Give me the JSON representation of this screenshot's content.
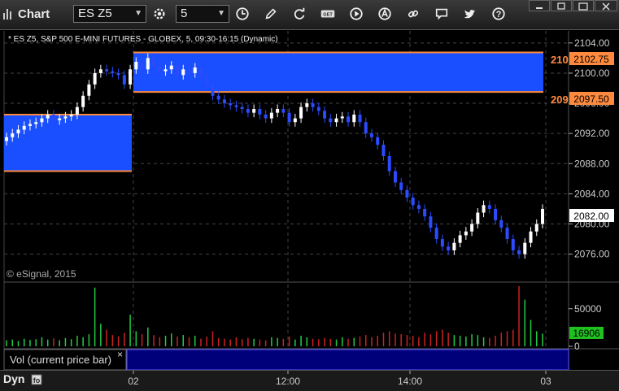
{
  "toolbar": {
    "app_title": "Chart",
    "symbol": "ES Z5",
    "interval": "5"
  },
  "chart": {
    "header": "* ES Z5, S&P 500 E-MINI FUTURES - GLOBEX, 5, 09:30-16:15 (Dynamic)",
    "copyright": "© eSignal, 2015",
    "price_ticks": [
      "2104.00",
      "2100.00",
      "2096.00",
      "2092.00",
      "2088.00",
      "2084.00",
      "2080.00",
      "2076.00"
    ],
    "price_min": 2072.4,
    "price_max": 2105.6,
    "current_price": "2082.00",
    "upper_level": "2102.75",
    "upper_level_clipped": "210",
    "lower_level": "2097.50",
    "lower_level_clipped": "209",
    "time_labels": [
      "02",
      "12:00",
      "14:00",
      "03"
    ],
    "volume_ticks": [
      "50000",
      "0"
    ],
    "volume_current": "16906",
    "volume_max": 80000,
    "volume_panel_label": "Vol (current price bar)",
    "close_mark": "×",
    "status_label": "Dyn",
    "colors": {
      "box": "#1a4fff",
      "level_line": "#ff8a3d",
      "up": "#ffffff",
      "down": "#2b4bff",
      "vol_up": "#22cc44",
      "vol_down": "#cc2222",
      "price_tag": "#ffffff",
      "vol_tag": "#21c021"
    }
  },
  "chart_data": {
    "type": "candlestick",
    "boxes": [
      {
        "session": "prior",
        "high": 2094.5,
        "low": 2087.0
      },
      {
        "session": "current",
        "high": 2102.75,
        "low": 2097.5
      }
    ],
    "closes": [
      2091.5,
      2092.0,
      2092.5,
      2093.0,
      2093.25,
      2093.5,
      2094.0,
      2094.5,
      2093.75,
      2094.0,
      2094.25,
      2094.5,
      2095.5,
      2097.0,
      2098.5,
      2100.0,
      2100.5,
      2100.25,
      2100.0,
      2099.75,
      2098.5,
      2100.5,
      2101.5,
      2100.5,
      2102.0,
      2101.0,
      2100.25,
      2100.5,
      2101.0,
      2099.75,
      2100.5,
      2100.0,
      2100.75,
      2099.5,
      2098.5,
      2097.0,
      2096.5,
      2096.0,
      2095.75,
      2095.5,
      2095.25,
      2094.75,
      2095.25,
      2094.5,
      2094.0,
      2094.75,
      2095.25,
      2094.75,
      2093.5,
      2094.0,
      2095.5,
      2096.0,
      2095.5,
      2095.0,
      2094.0,
      2093.5,
      2094.0,
      2094.25,
      2093.5,
      2094.5,
      2093.5,
      2092.0,
      2091.5,
      2090.5,
      2089.0,
      2087.0,
      2085.5,
      2084.5,
      2083.5,
      2082.5,
      2082.0,
      2081.0,
      2079.5,
      2078.0,
      2077.0,
      2076.5,
      2077.5,
      2078.5,
      2079.0,
      2080.0,
      2081.5,
      2082.5,
      2082.0,
      2080.5,
      2079.5,
      2078.0,
      2076.5,
      2076.0,
      2077.5,
      2079.0,
      2080.0,
      2082.0
    ]
  }
}
